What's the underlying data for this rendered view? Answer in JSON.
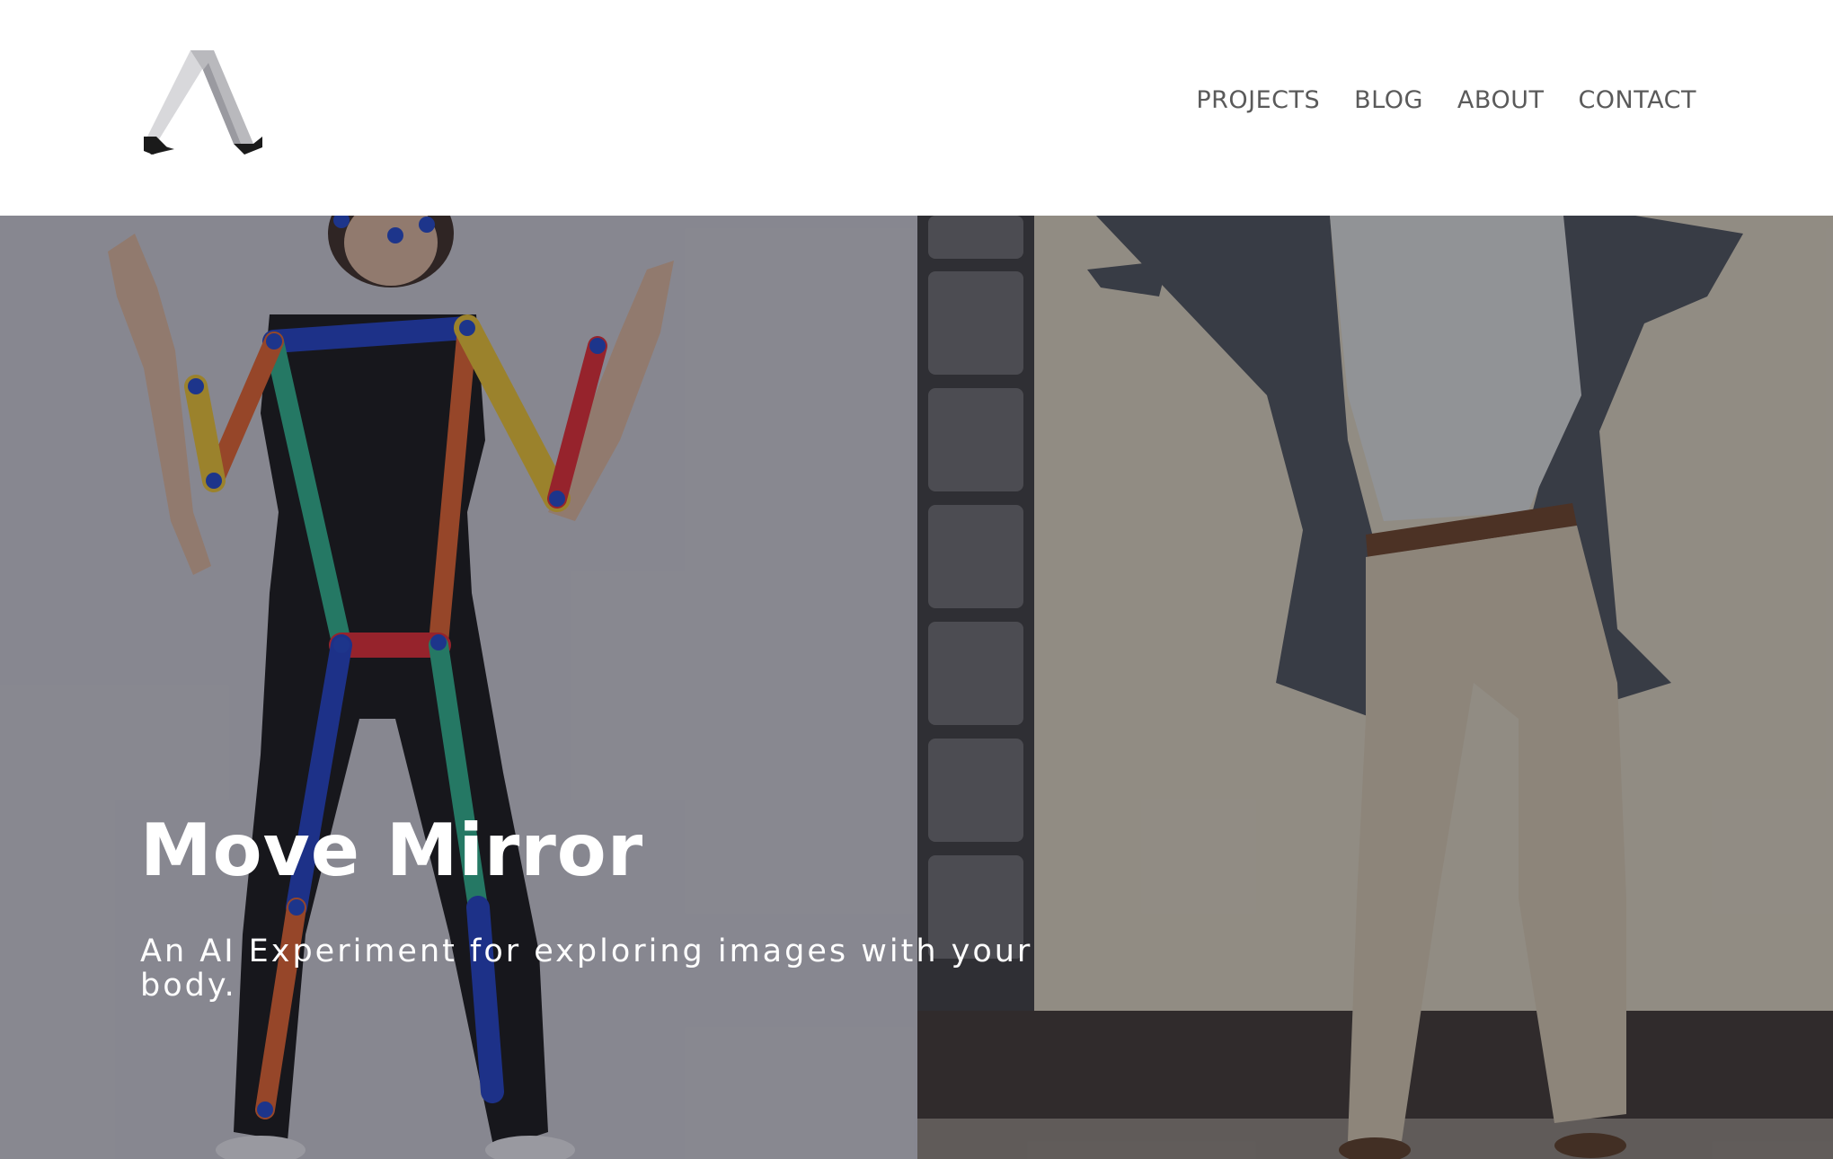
{
  "header": {
    "logo_icon": "impossible-triangle-logo-icon",
    "nav": {
      "projects": "PROJECTS",
      "blog": "BLOG",
      "about": "ABOUT",
      "contact": "CONTACT"
    }
  },
  "hero": {
    "title": "Move Mirror",
    "subtitle": "An AI Experiment for exploring images with your body.",
    "skeleton_colors": {
      "keypoint": "#1e44c8",
      "torso_top": "#1e3ec4",
      "left_side": "#2ab08a",
      "right_side": "#e0602a",
      "hips": "#e02830",
      "arm_yellow": "#e8c030",
      "arm_red": "#e02830"
    }
  }
}
